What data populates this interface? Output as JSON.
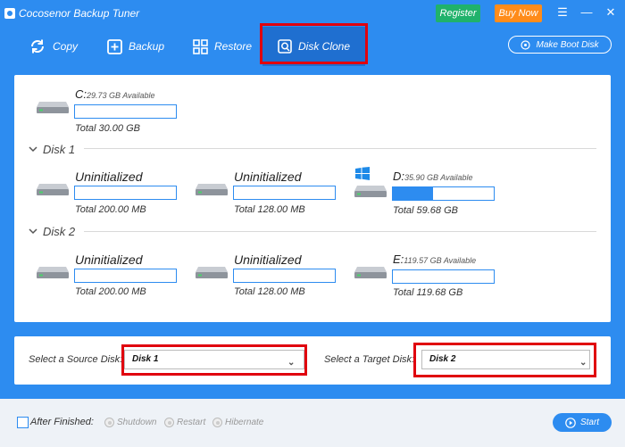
{
  "app": {
    "title": "Cocosenor Backup Tuner"
  },
  "header": {
    "register_label": "Register",
    "buy_label": "Buy Now",
    "menu_glyph": "☰",
    "minimize_glyph": "—",
    "close_glyph": "✕"
  },
  "toolbar": {
    "copy_label": "Copy",
    "backup_label": "Backup",
    "restore_label": "Restore",
    "disk_clone_label": "Disk Clone",
    "boot_disk_label": "Make Boot Disk"
  },
  "disk0": {
    "drive_letter": "C:",
    "available": "29.73 GB Available",
    "total": "Total 30.00 GB",
    "used_fraction": 0.0
  },
  "disk1": {
    "label": "Disk 1",
    "partitions": [
      {
        "name": "Uninitialized",
        "available": "",
        "total": "Total 200.00 MB",
        "used_fraction": 0.0
      },
      {
        "name": "Uninitialized",
        "available": "",
        "total": "Total 128.00 MB",
        "used_fraction": 0.0
      },
      {
        "name": "D:",
        "available": "35.90 GB Available",
        "total": "Total 59.68 GB",
        "used_fraction": 0.4
      }
    ]
  },
  "disk2": {
    "label": "Disk 2",
    "partitions": [
      {
        "name": "Uninitialized",
        "available": "",
        "total": "Total 200.00 MB",
        "used_fraction": 0.0
      },
      {
        "name": "Uninitialized",
        "available": "",
        "total": "Total 128.00 MB",
        "used_fraction": 0.0
      },
      {
        "name": "E:",
        "available": "119.57 GB Available",
        "total": "Total 119.68 GB",
        "used_fraction": 0.0
      }
    ]
  },
  "clone": {
    "source_label": "Select a Source Disk:",
    "source_value": "Disk 1",
    "target_label": "Select a Target Disk:",
    "target_value": "Disk 2"
  },
  "footer": {
    "after_finished_label": "After Finished:",
    "shutdown_label": "Shutdown",
    "restart_label": "Restart",
    "hibernate_label": "Hibernate",
    "start_label": "Start"
  },
  "colors": {
    "accent": "#2d8cf0",
    "highlight": "#e0000e",
    "register": "#20b26b",
    "buy": "#ff8c1a"
  }
}
